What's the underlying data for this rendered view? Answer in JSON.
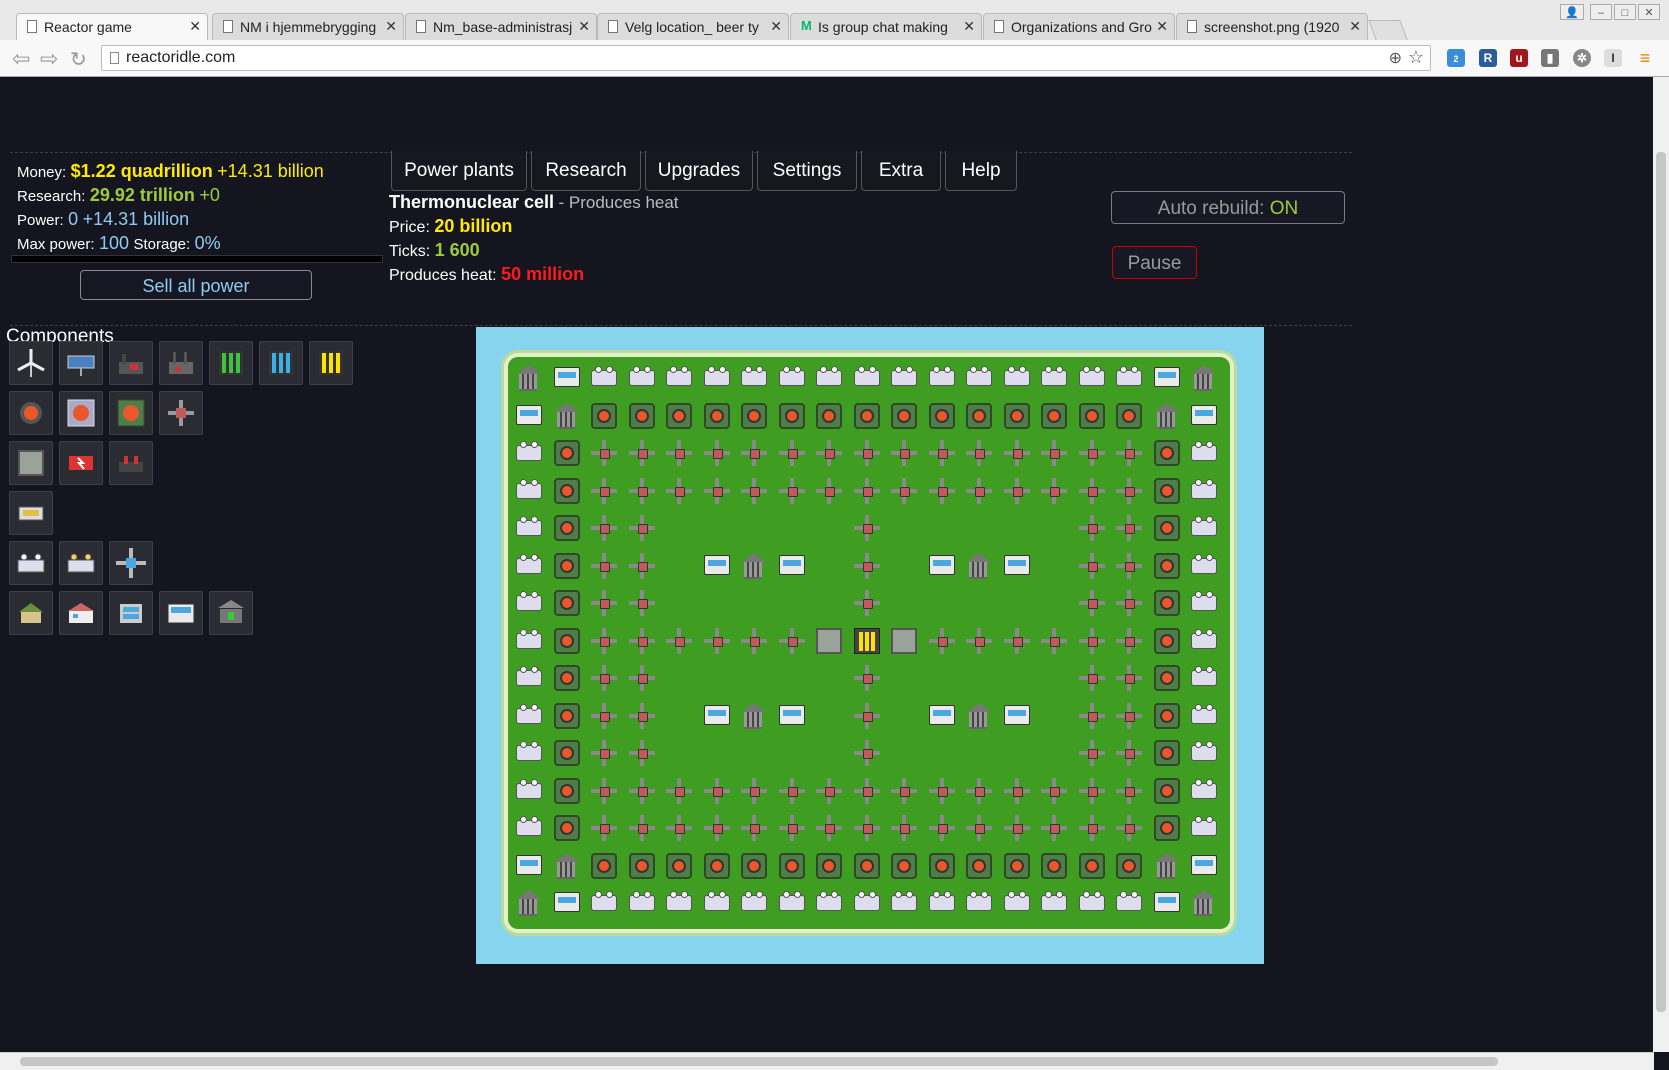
{
  "browser": {
    "tabs": [
      {
        "title": "Reactor game",
        "icon": "page-icon",
        "active": true
      },
      {
        "title": "NM i hjemmebrygging",
        "icon": "page-icon"
      },
      {
        "title": "Nm_base-administrasj",
        "icon": "page-icon"
      },
      {
        "title": "Velg location_ beer ty",
        "icon": "page-icon"
      },
      {
        "title": "Is group chat making",
        "icon": "medium-icon"
      },
      {
        "title": "Organizations and Gro",
        "icon": "page-icon"
      },
      {
        "title": "screenshot.png (1920",
        "icon": "page-icon"
      }
    ],
    "close_glyph": "✕",
    "url": "reactoridle.com",
    "extension_badge": "2"
  },
  "stats": {
    "money_label": "Money:",
    "money_value": "$1.22 quadrillion",
    "money_rate": "+14.31 billion",
    "research_label": "Research:",
    "research_value": "29.92 trillion",
    "research_rate": "+0",
    "power_label": "Power:",
    "power_value": "0",
    "power_rate": "+14.31 billion",
    "maxpower_label": "Max power:",
    "maxpower_value": "100",
    "storage_label": "Storage:",
    "storage_value": "0%",
    "power_fill": 0
  },
  "sell_button": "Sell all power",
  "nav_tabs": [
    "Power plants",
    "Research",
    "Upgrades",
    "Settings",
    "Extra",
    "Help"
  ],
  "info": {
    "name": "Thermonuclear cell",
    "desc": "- Produces heat",
    "price_label": "Price:",
    "price_value": "20 billion",
    "ticks_label": "Ticks:",
    "ticks_value": "1 600",
    "heat_label": "Produces heat:",
    "heat_value": "50 million"
  },
  "auto_rebuild": {
    "label": "Auto rebuild:",
    "value": "ON"
  },
  "pause_button": "Pause",
  "components_title": "Components",
  "component_rows": [
    [
      "wind-turbine-icon",
      "solar-panel-icon",
      "coal-plant-icon",
      "gas-plant-icon",
      "fuel-cell-green-icon",
      "fuel-cell-blue-icon",
      "fuel-cell-yellow-icon"
    ],
    [
      "heat-vent-icon",
      "advanced-vent-icon",
      "large-vent-icon",
      "heat-exchanger-icon"
    ],
    [
      "reactor-plating-icon",
      "heat-inlet-icon",
      "heat-outlet-icon"
    ],
    [
      "battery-icon"
    ],
    [
      "capacitor-icon",
      "large-capacitor-icon",
      "heat-pipe-icon"
    ],
    [
      "small-house-icon",
      "house-icon",
      "office-icon",
      "apartment-icon",
      "bank-icon"
    ]
  ],
  "colors": {
    "money": "#ffea00",
    "research": "#9ccc3a",
    "power": "#8ecbf0",
    "heat": "#ff1a1a",
    "pause_border": "#cc0000",
    "background": "#14151f"
  }
}
